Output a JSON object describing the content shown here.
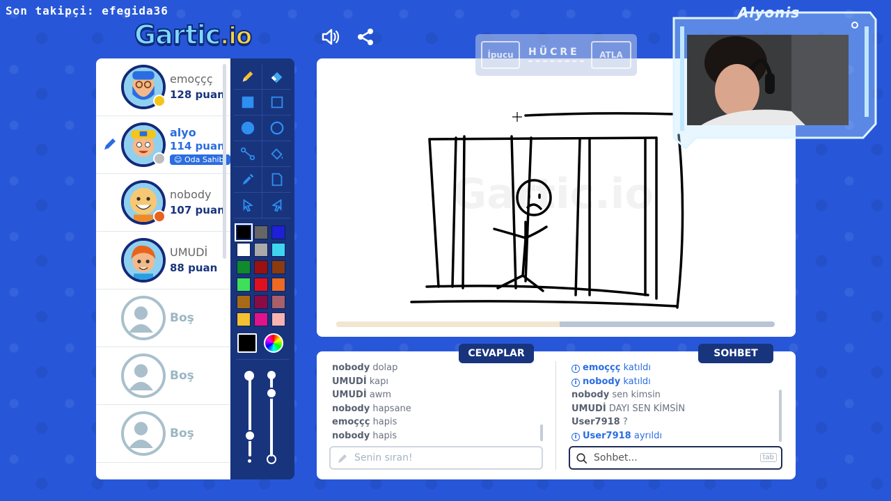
{
  "stream": {
    "follower_text": "Son takipçi: efegida36",
    "cam_name": "Alyonis"
  },
  "app": {
    "logo_main": "Gartic",
    "logo_tld": ".io"
  },
  "players": [
    {
      "name": "emoççç",
      "score": "128 puan",
      "status_color": "#f5c518",
      "avatar": "beard"
    },
    {
      "name": "alyo",
      "score": "114 puan",
      "status_color": "#bdbdbd",
      "badge": "Oda Sahibi",
      "drawing": true,
      "avatar": "cap"
    },
    {
      "name": "nobody",
      "score": "107 puan",
      "status_color": "#e8641c",
      "avatar": "bald"
    },
    {
      "name": "UMUDİ",
      "score": "88 puan",
      "avatar": "redhair"
    },
    {
      "empty_label": "Boş"
    },
    {
      "empty_label": "Boş"
    },
    {
      "empty_label": "Boş"
    }
  ],
  "tools": [
    "pencil-icon",
    "eraser-icon",
    "filled-square-icon",
    "square-outline-icon",
    "filled-circle-icon",
    "circle-outline-icon",
    "line-icon",
    "fill-bucket-icon",
    "eyedropper-icon",
    "new-page-icon",
    "undo-icon",
    "redo-icon"
  ],
  "palette": [
    "#000000",
    "#666666",
    "#1f1fd6",
    "#ffffff",
    "#aaaaaa",
    "#3fd5f0",
    "#0f8a2c",
    "#9b1010",
    "#8b3b10",
    "#3ee05a",
    "#e0101e",
    "#ee6a22",
    "#a86a16",
    "#8b0b44",
    "#a8606a",
    "#f5c030",
    "#e0138a",
    "#f6b3b0"
  ],
  "current_color": "#000000",
  "hint_bar": {
    "hint_button": "İpucu",
    "word": "HÜCRE",
    "skip_button": "ATLA"
  },
  "timer": {
    "progress_percent": 51
  },
  "answers": {
    "tab_label": "CEVAPLAR",
    "messages": [
      {
        "user": "nobody",
        "text": "dolap"
      },
      {
        "user": "UMUDİ",
        "text": "kapı"
      },
      {
        "user": "UMUDİ",
        "text": "awm"
      },
      {
        "user": "nobody",
        "text": "hapsane"
      },
      {
        "user": "emoççç",
        "text": "hapis"
      },
      {
        "user": "nobody",
        "text": "hapis"
      }
    ],
    "input_placeholder": "Senin sıran!"
  },
  "chat": {
    "tab_label": "SOHBET",
    "messages": [
      {
        "user": "emoççç",
        "text": "katıldı",
        "system": true
      },
      {
        "user": "nobody",
        "text": "katıldı",
        "system": true
      },
      {
        "user": "nobody",
        "text": "sen kimsin"
      },
      {
        "user": "UMUDİ",
        "text": "DAYI SEN KİMSİN"
      },
      {
        "user": "User7918",
        "text": "?"
      },
      {
        "user": "User7918",
        "text": "ayrıldı",
        "system": true
      }
    ],
    "input_placeholder": "Sohbet...",
    "shortcut_key": "tab"
  }
}
